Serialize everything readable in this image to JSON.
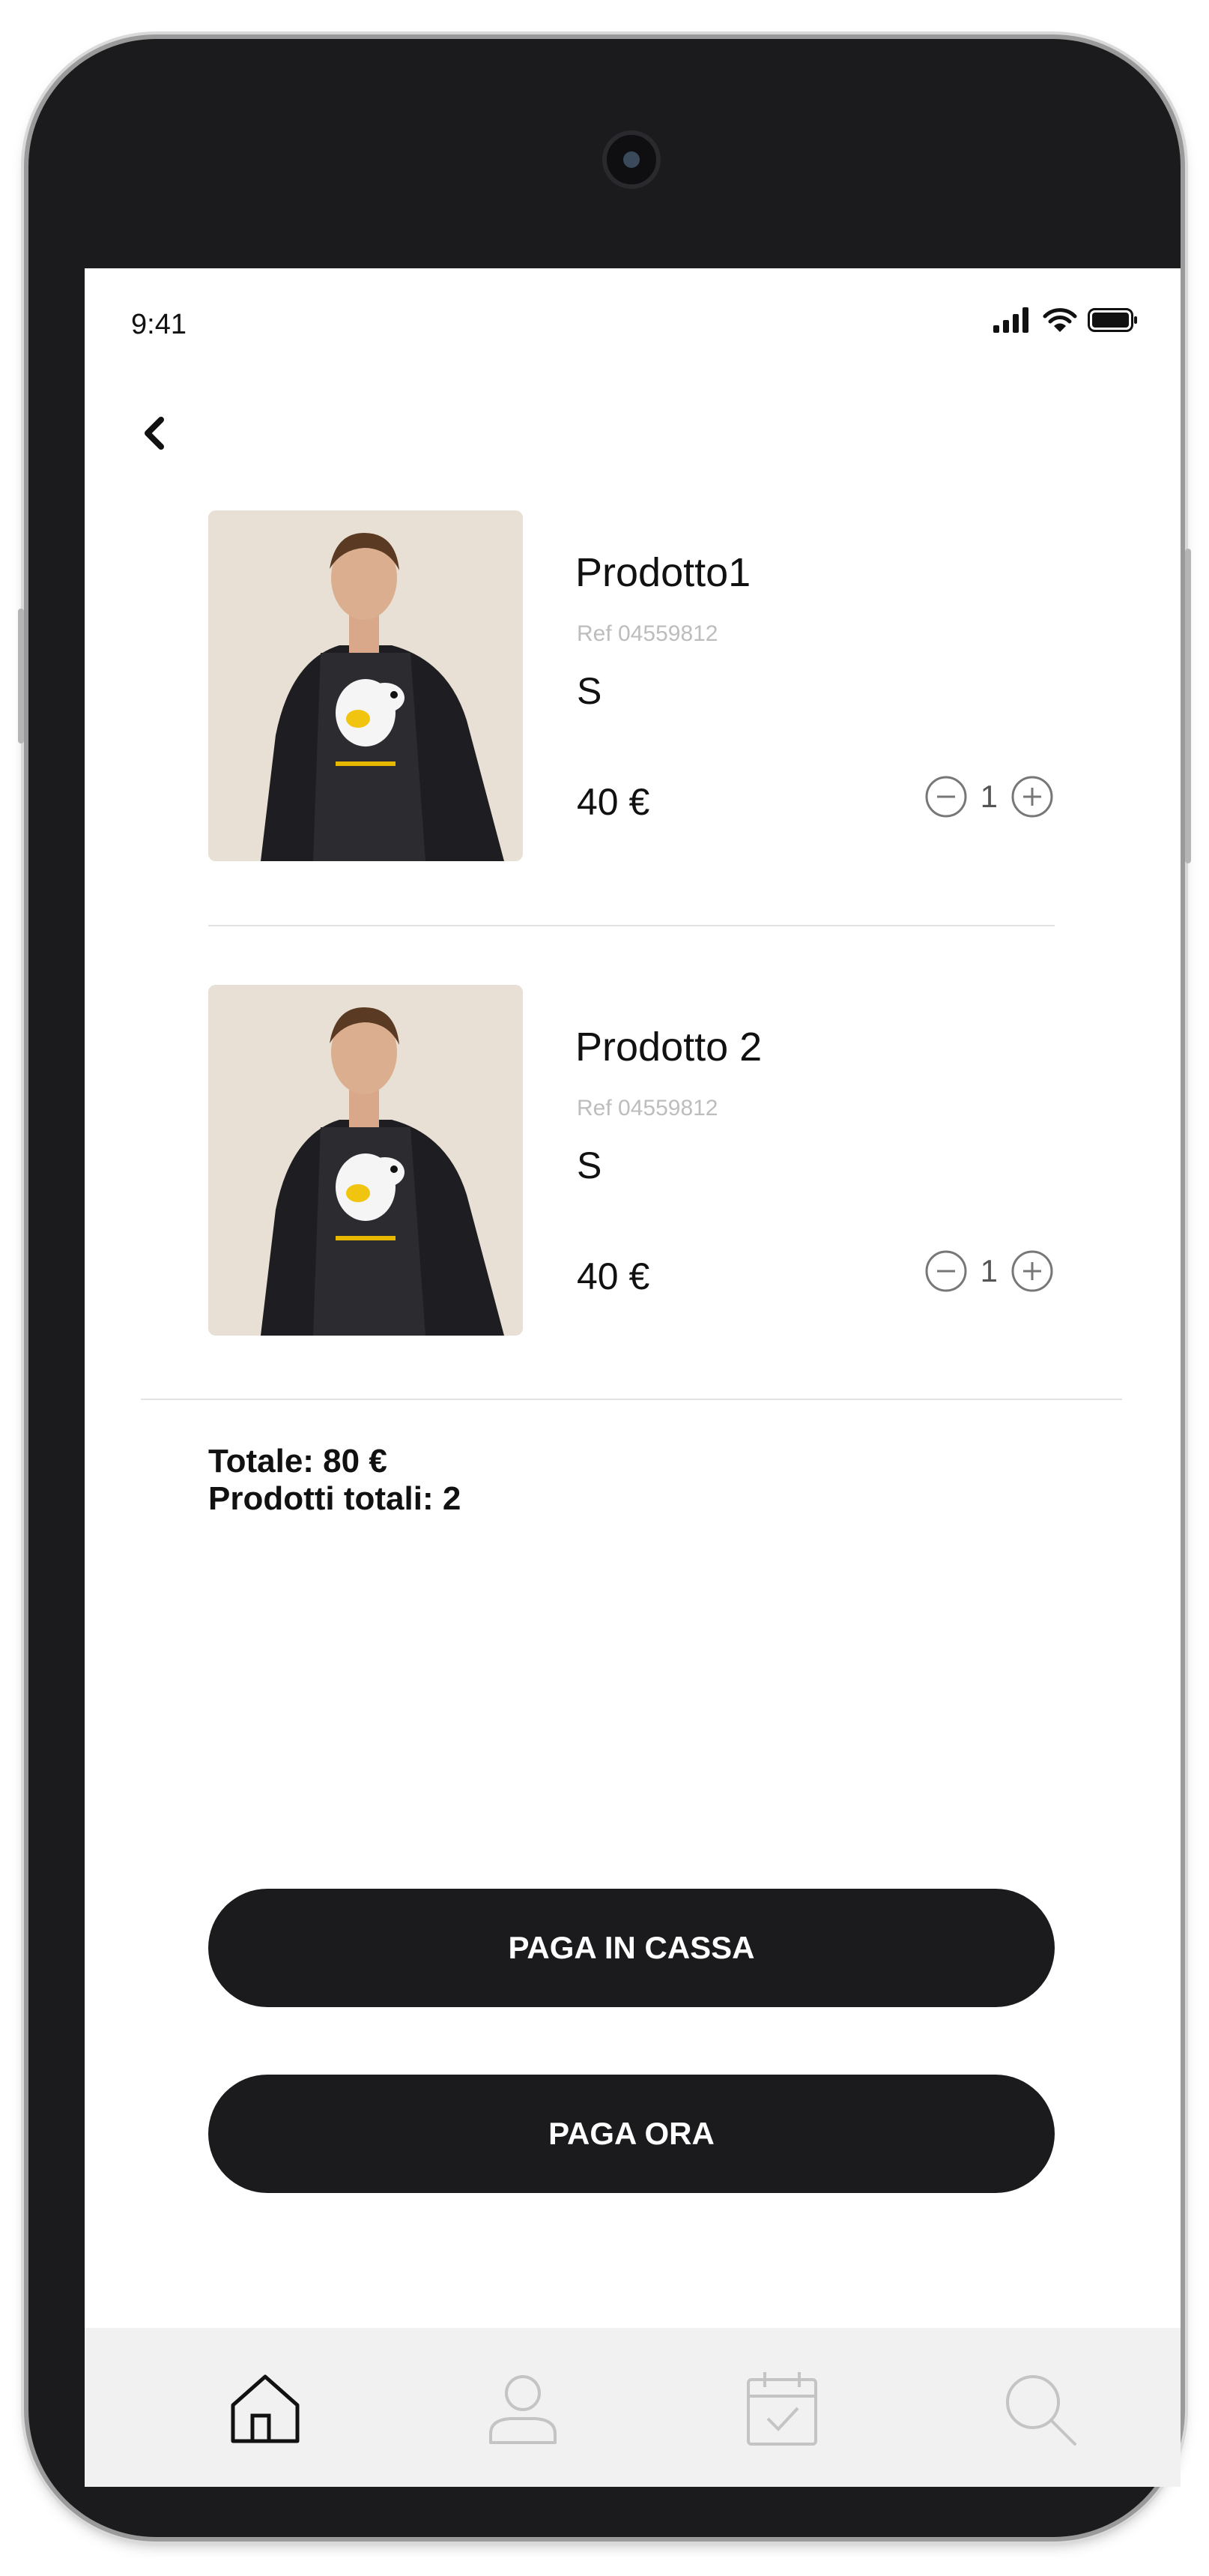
{
  "status_bar": {
    "time": "9:41"
  },
  "cart": {
    "items": [
      {
        "name": "Prodotto1",
        "ref": "Ref 04559812",
        "size": "S",
        "price": "40 €",
        "quantity": "1"
      },
      {
        "name": "Prodotto 2",
        "ref": "Ref 04559812",
        "size": "S",
        "price": "40 €",
        "quantity": "1"
      }
    ],
    "total_label": "Totale: 80 €",
    "products_count_label": "Prodotti totali: 2"
  },
  "actions": {
    "pay_in_store": "PAGA IN CASSA",
    "pay_now": "PAGA ORA"
  },
  "tab_bar": {
    "items": [
      {
        "icon": "home-icon",
        "active": true
      },
      {
        "icon": "user-icon",
        "active": false
      },
      {
        "icon": "calendar-check-icon",
        "active": false
      },
      {
        "icon": "search-icon",
        "active": false
      }
    ]
  },
  "colors": {
    "accent": "#1b1b1d",
    "text": "#111111",
    "muted": "#bdbdbd",
    "inactive_icon": "#c4c4c4",
    "tab_bar_bg": "#f1f1f1"
  }
}
